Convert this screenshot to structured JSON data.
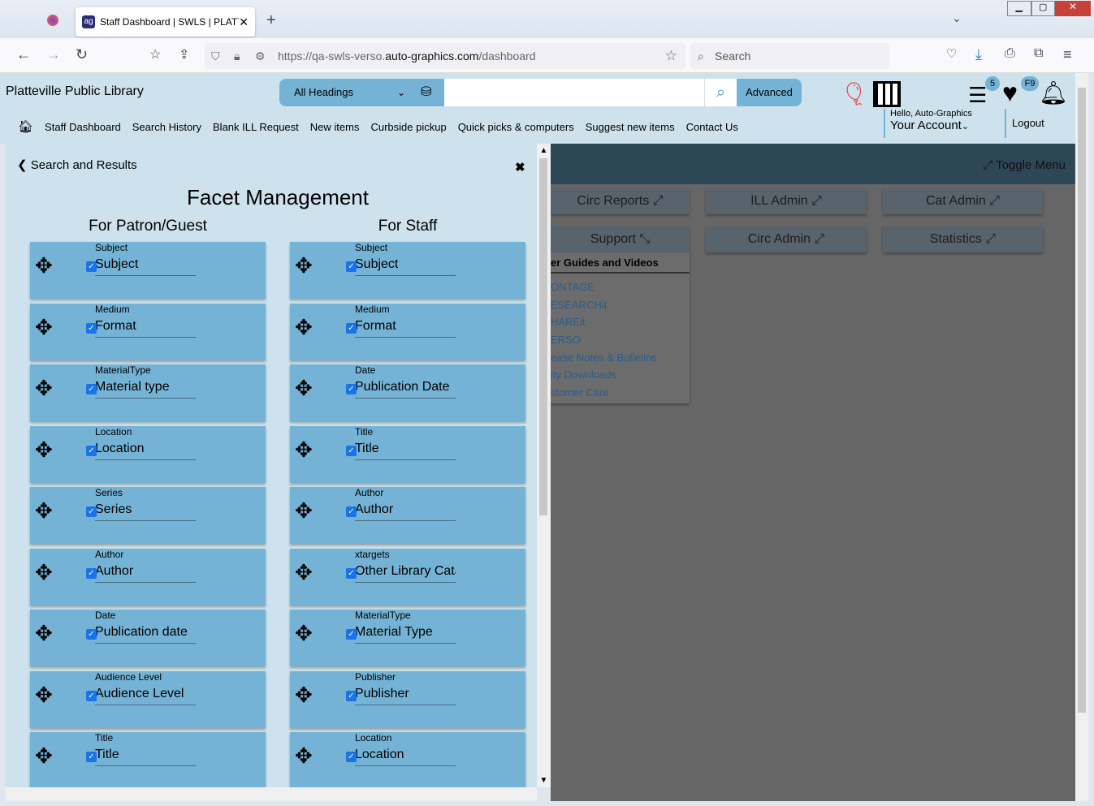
{
  "browser": {
    "tab_title": "Staff Dashboard | SWLS | PLATT",
    "url_prefix": "https://qa-swls-verso.",
    "url_domain": "auto-graphics.com",
    "url_path": "/dashboard",
    "search_placeholder": "Search"
  },
  "header": {
    "library_name": "Platteville Public Library",
    "search_scope": "All Headings",
    "advanced_label": "Advanced",
    "list_badge": "5",
    "favorites_badge": "F9",
    "greeting": "Hello, Auto-Graphics",
    "account_label": "Your Account",
    "logout_label": "Logout"
  },
  "nav": [
    "Staff Dashboard",
    "Search History",
    "Blank ILL Request",
    "New items",
    "Curbside pickup",
    "Quick picks & computers",
    "Suggest new items",
    "Contact Us"
  ],
  "panel": {
    "back_label": "Search and Results",
    "title": "Facet Management",
    "patron_heading": "For Patron/Guest",
    "staff_heading": "For Staff",
    "patron": [
      {
        "field": "Subject",
        "label": "Subject"
      },
      {
        "field": "Medium",
        "label": "Format"
      },
      {
        "field": "MaterialType",
        "label": "Material type"
      },
      {
        "field": "Location",
        "label": "Location"
      },
      {
        "field": "Series",
        "label": "Series"
      },
      {
        "field": "Author",
        "label": "Author"
      },
      {
        "field": "Date",
        "label": "Publication date"
      },
      {
        "field": "Audience Level",
        "label": "Audience Level"
      },
      {
        "field": "Title",
        "label": "Title"
      }
    ],
    "staff": [
      {
        "field": "Subject",
        "label": "Subject"
      },
      {
        "field": "Medium",
        "label": "Format"
      },
      {
        "field": "Date",
        "label": "Publication Date"
      },
      {
        "field": "Title",
        "label": "Title"
      },
      {
        "field": "Author",
        "label": "Author"
      },
      {
        "field": "xtargets",
        "label": "Other Library Catalogs"
      },
      {
        "field": "MaterialType",
        "label": "Material Type"
      },
      {
        "field": "Publisher",
        "label": "Publisher"
      },
      {
        "field": "Location",
        "label": "Location"
      }
    ]
  },
  "dashboard": {
    "toggle_menu": "Toggle Menu",
    "buttons": [
      "Circ Reports",
      "ILL Admin",
      "Cat Admin",
      "Support",
      "Circ Admin",
      "Statistics"
    ],
    "support_heading": "er Guides and Videos",
    "support_links": [
      "ONTAGE",
      "ESEARCHit",
      "HAREit",
      "ERSO",
      "ease Notes & Bulletins",
      "ity Downloads",
      "stomer Care"
    ]
  }
}
